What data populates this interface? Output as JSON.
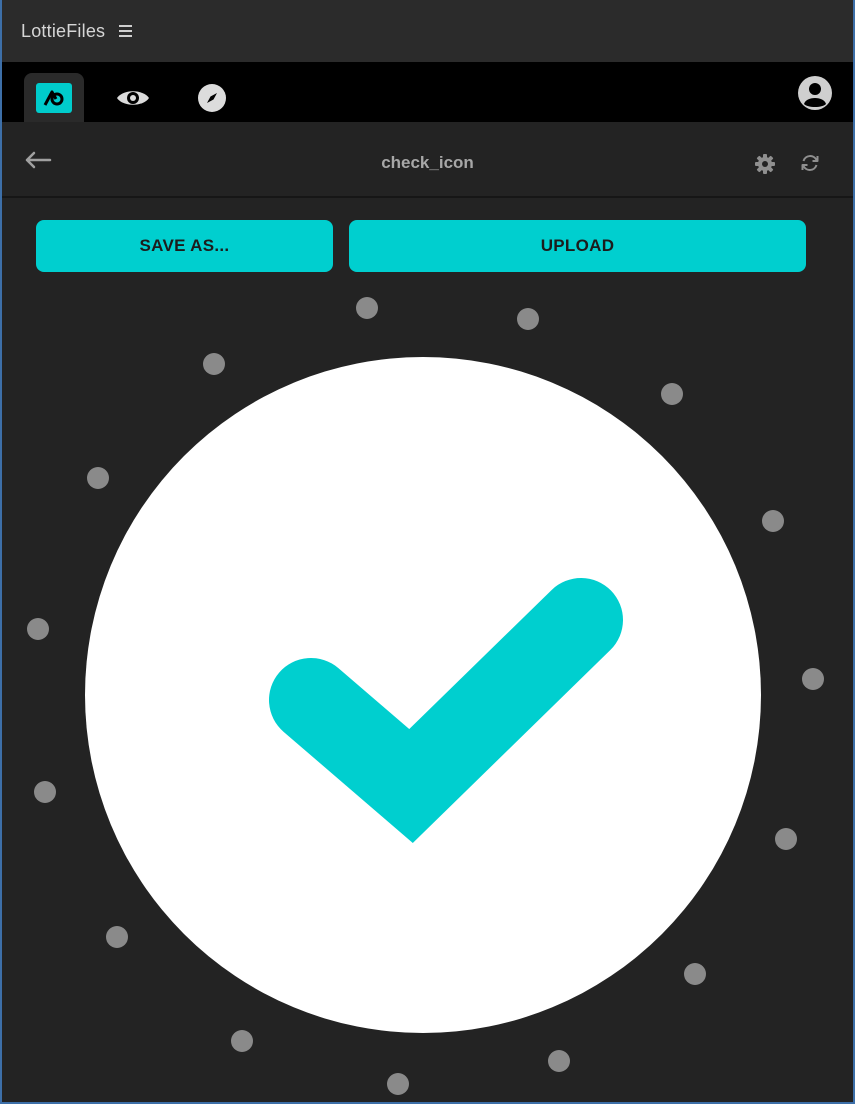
{
  "app": {
    "title": "LottieFiles"
  },
  "tabs": [
    {
      "name": "lottie-logo",
      "active": true
    },
    {
      "name": "preview",
      "active": false
    },
    {
      "name": "discover",
      "active": false
    }
  ],
  "header": {
    "title": "check_icon"
  },
  "buttons": {
    "save_as": "SAVE AS...",
    "upload": "UPLOAD"
  },
  "colors": {
    "accent": "#00cfcf",
    "background": "#232323",
    "titlebar": "#2b2b2b",
    "tabbar": "#000000",
    "dot": "#8a8a8a",
    "circle": "#ffffff"
  },
  "icons": {
    "menu": "hamburger-icon",
    "back": "arrow-left-icon",
    "settings": "gear-icon",
    "refresh": "refresh-icon",
    "account": "user-avatar-icon",
    "preview_tab": "eye-icon",
    "discover_tab": "compass-icon",
    "animation": "check-icon"
  }
}
